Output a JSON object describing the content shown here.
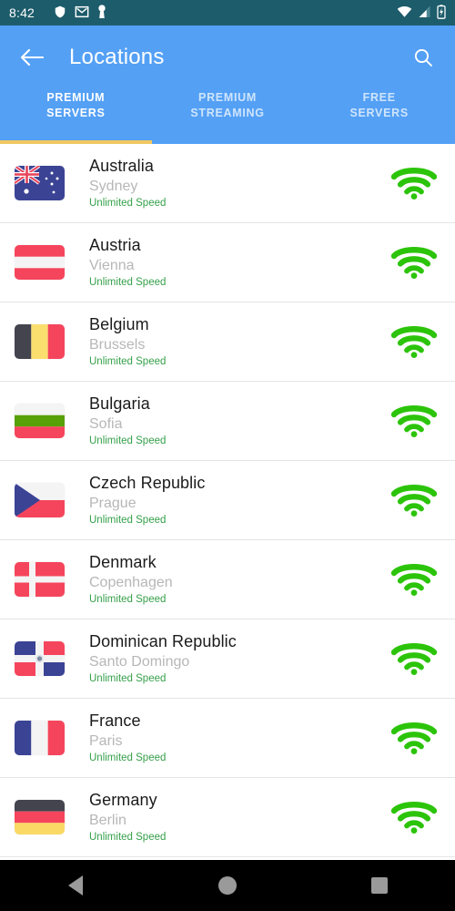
{
  "status_bar": {
    "time": "8:42",
    "left_icons": [
      "shield-icon",
      "gmail-icon",
      "vpn-key-icon"
    ],
    "right_icons": [
      "wifi-icon",
      "cellular-signal-icon",
      "battery-charging-icon"
    ],
    "background_color": "#1d5c6b"
  },
  "app_bar": {
    "title": "Locations",
    "back_icon": "back-arrow-icon",
    "search_icon": "search-icon",
    "background_color": "#54a0f5"
  },
  "tabs": {
    "indicator_color": "#f0c860",
    "active_index": 0,
    "items": [
      {
        "label": "PREMIUM\nSERVERS",
        "line1": "PREMIUM",
        "line2": "SERVERS",
        "active": true
      },
      {
        "label": "PREMIUM\nSTREAMING",
        "line1": "PREMIUM",
        "line2": "STREAMING",
        "active": false
      },
      {
        "label": "FREE\nSERVERS",
        "line1": "FREE",
        "line2": "SERVERS",
        "active": false
      }
    ]
  },
  "list": {
    "speed_color": "#35a04a",
    "signal_icon": "wifi-signal-icon",
    "items": [
      {
        "country": "Australia",
        "city": "Sydney",
        "speed": "Unlimited Speed",
        "flag": "au"
      },
      {
        "country": "Austria",
        "city": "Vienna",
        "speed": "Unlimited Speed",
        "flag": "at"
      },
      {
        "country": "Belgium",
        "city": "Brussels",
        "speed": "Unlimited Speed",
        "flag": "be"
      },
      {
        "country": "Bulgaria",
        "city": "Sofia",
        "speed": "Unlimited Speed",
        "flag": "bg"
      },
      {
        "country": "Czech Republic",
        "city": "Prague",
        "speed": "Unlimited Speed",
        "flag": "cz"
      },
      {
        "country": "Denmark",
        "city": "Copenhagen",
        "speed": "Unlimited Speed",
        "flag": "dk"
      },
      {
        "country": "Dominican Republic",
        "city": "Santo Domingo",
        "speed": "Unlimited Speed",
        "flag": "do"
      },
      {
        "country": "France",
        "city": "Paris",
        "speed": "Unlimited Speed",
        "flag": "fr"
      },
      {
        "country": "Germany",
        "city": "Berlin",
        "speed": "Unlimited Speed",
        "flag": "de"
      }
    ]
  },
  "nav_bar": {
    "background_color": "#000000",
    "buttons": [
      {
        "name": "nav-back-button",
        "icon": "triangle-back-icon"
      },
      {
        "name": "nav-home-button",
        "icon": "circle-home-icon"
      },
      {
        "name": "nav-recents-button",
        "icon": "square-recents-icon"
      }
    ]
  }
}
